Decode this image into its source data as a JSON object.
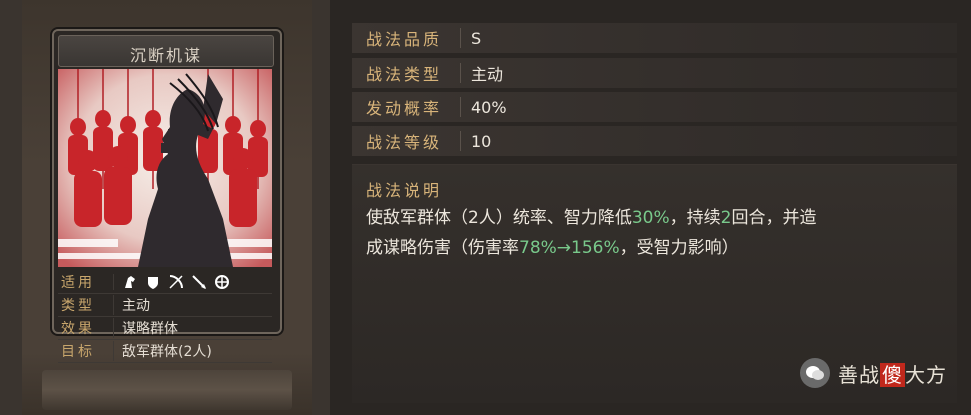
{
  "card": {
    "title": "沉断机谋",
    "rows": [
      {
        "label": "适用",
        "value": ""
      },
      {
        "label": "类型",
        "value": "主动"
      },
      {
        "label": "效果",
        "value": "谋略群体"
      },
      {
        "label": "目标",
        "value": "敌军群体(2人)"
      }
    ],
    "applicable_icons": [
      "cavalry-icon",
      "shield-icon",
      "bow-icon",
      "spear-icon",
      "chariot-icon"
    ]
  },
  "props": [
    {
      "label": "战法品质",
      "value": "S"
    },
    {
      "label": "战法类型",
      "value": "主动"
    },
    {
      "label": "发动概率",
      "value": "40%"
    },
    {
      "label": "战法等级",
      "value": "10"
    }
  ],
  "description": {
    "title": "战法说明",
    "line1_a": "使敌军群体（2人）统率、智力降低",
    "line1_hl": "30%",
    "line1_b": "，持续",
    "line1_hl2": "2",
    "line1_c": "回合，并造",
    "line2_a": "成谋略伤害（伤害率",
    "line2_hl": "78%→156%",
    "line2_b": "，受智力影响）"
  },
  "watermark": {
    "text_a": "善战",
    "text_b": "傻",
    "text_c": "大方"
  },
  "colors": {
    "label_gold": "#d8b47a",
    "highlight_green": "#79c98b",
    "artwork_red": "#c8252a"
  }
}
